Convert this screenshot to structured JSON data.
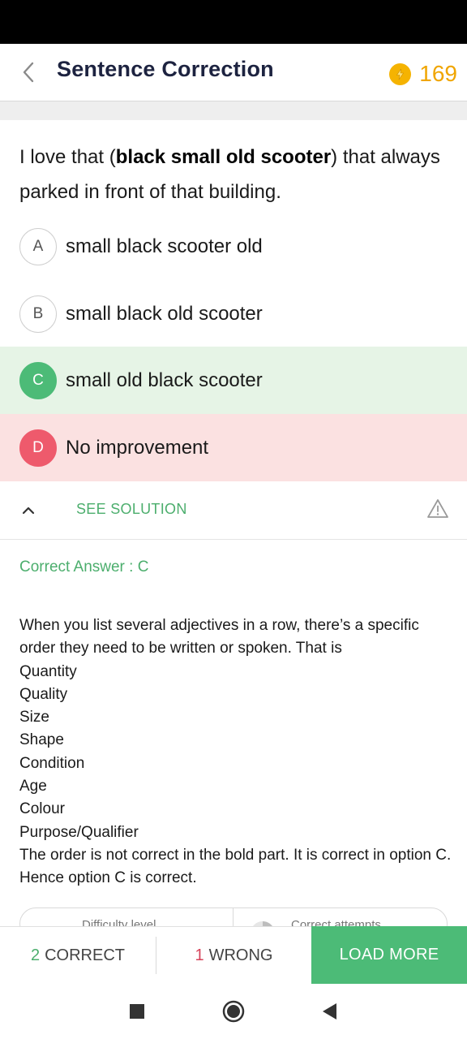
{
  "header": {
    "title": "Sentence Correction",
    "coins": "169",
    "back_icon": "chevron-left-icon",
    "coin_icon": "coin-icon"
  },
  "question": {
    "before": "I love that (",
    "bold": "black small old scooter",
    "after": ") that always parked in front of that building."
  },
  "options": [
    {
      "letter": "A",
      "text": "small black scooter old",
      "state": "neutral"
    },
    {
      "letter": "B",
      "text": "small black old scooter",
      "state": "neutral"
    },
    {
      "letter": "C",
      "text": "small old black scooter",
      "state": "correct"
    },
    {
      "letter": "D",
      "text": "No improvement",
      "state": "wrong"
    }
  ],
  "solution": {
    "toggle_label": "SEE SOLUTION",
    "correct_answer": "Correct Answer : C",
    "explanation": [
      "When you list several adjectives in a row, there’s a specific order they need to be written or spoken. That is",
      "Quantity",
      "Quality",
      "Size",
      "Shape",
      "Condition",
      "Age",
      "Colour",
      "Purpose/Qualifier",
      "The order is not correct in the bold part. It is correct in option C. Hence option C is correct."
    ]
  },
  "stats_pill": {
    "left": "Difficulty level",
    "right": "Correct attempts"
  },
  "bottom_bar": {
    "correct_count": "2",
    "correct_label": "CORRECT",
    "wrong_count": "1",
    "wrong_label": "WRONG",
    "load_more": "LOAD MORE"
  },
  "colors": {
    "accent_green": "#4cbb77",
    "wrong_red": "#ee5a6c",
    "title_navy": "#1d2340",
    "coin_gold": "#f0a500"
  }
}
